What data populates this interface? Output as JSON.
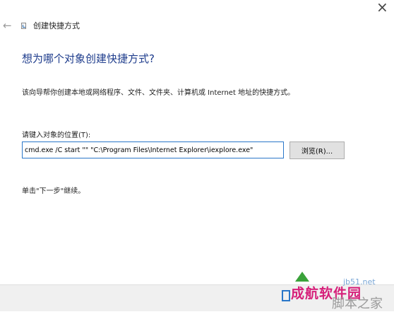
{
  "window": {
    "close_glyph": "×",
    "title": "创建快捷方式"
  },
  "nav": {
    "back_icon": "back-arrow-icon"
  },
  "page": {
    "heading": "想为哪个对象创建快捷方式?",
    "description": "该向导帮你创建本地或网络程序、文件、文件夹、计算机或 Internet 地址的快捷方式。",
    "location_label": "请键入对象的位置(T):",
    "location_value": "cmd.exe /C start \"\" \"C:\\Program Files\\Internet Explorer\\iexplore.exe\"",
    "browse_label": "浏览(R)...",
    "hint": "单击\"下一步\"继续。"
  },
  "watermark": {
    "small": "jb51.net",
    "brand": "成航软件园",
    "site": "脚本之家"
  }
}
